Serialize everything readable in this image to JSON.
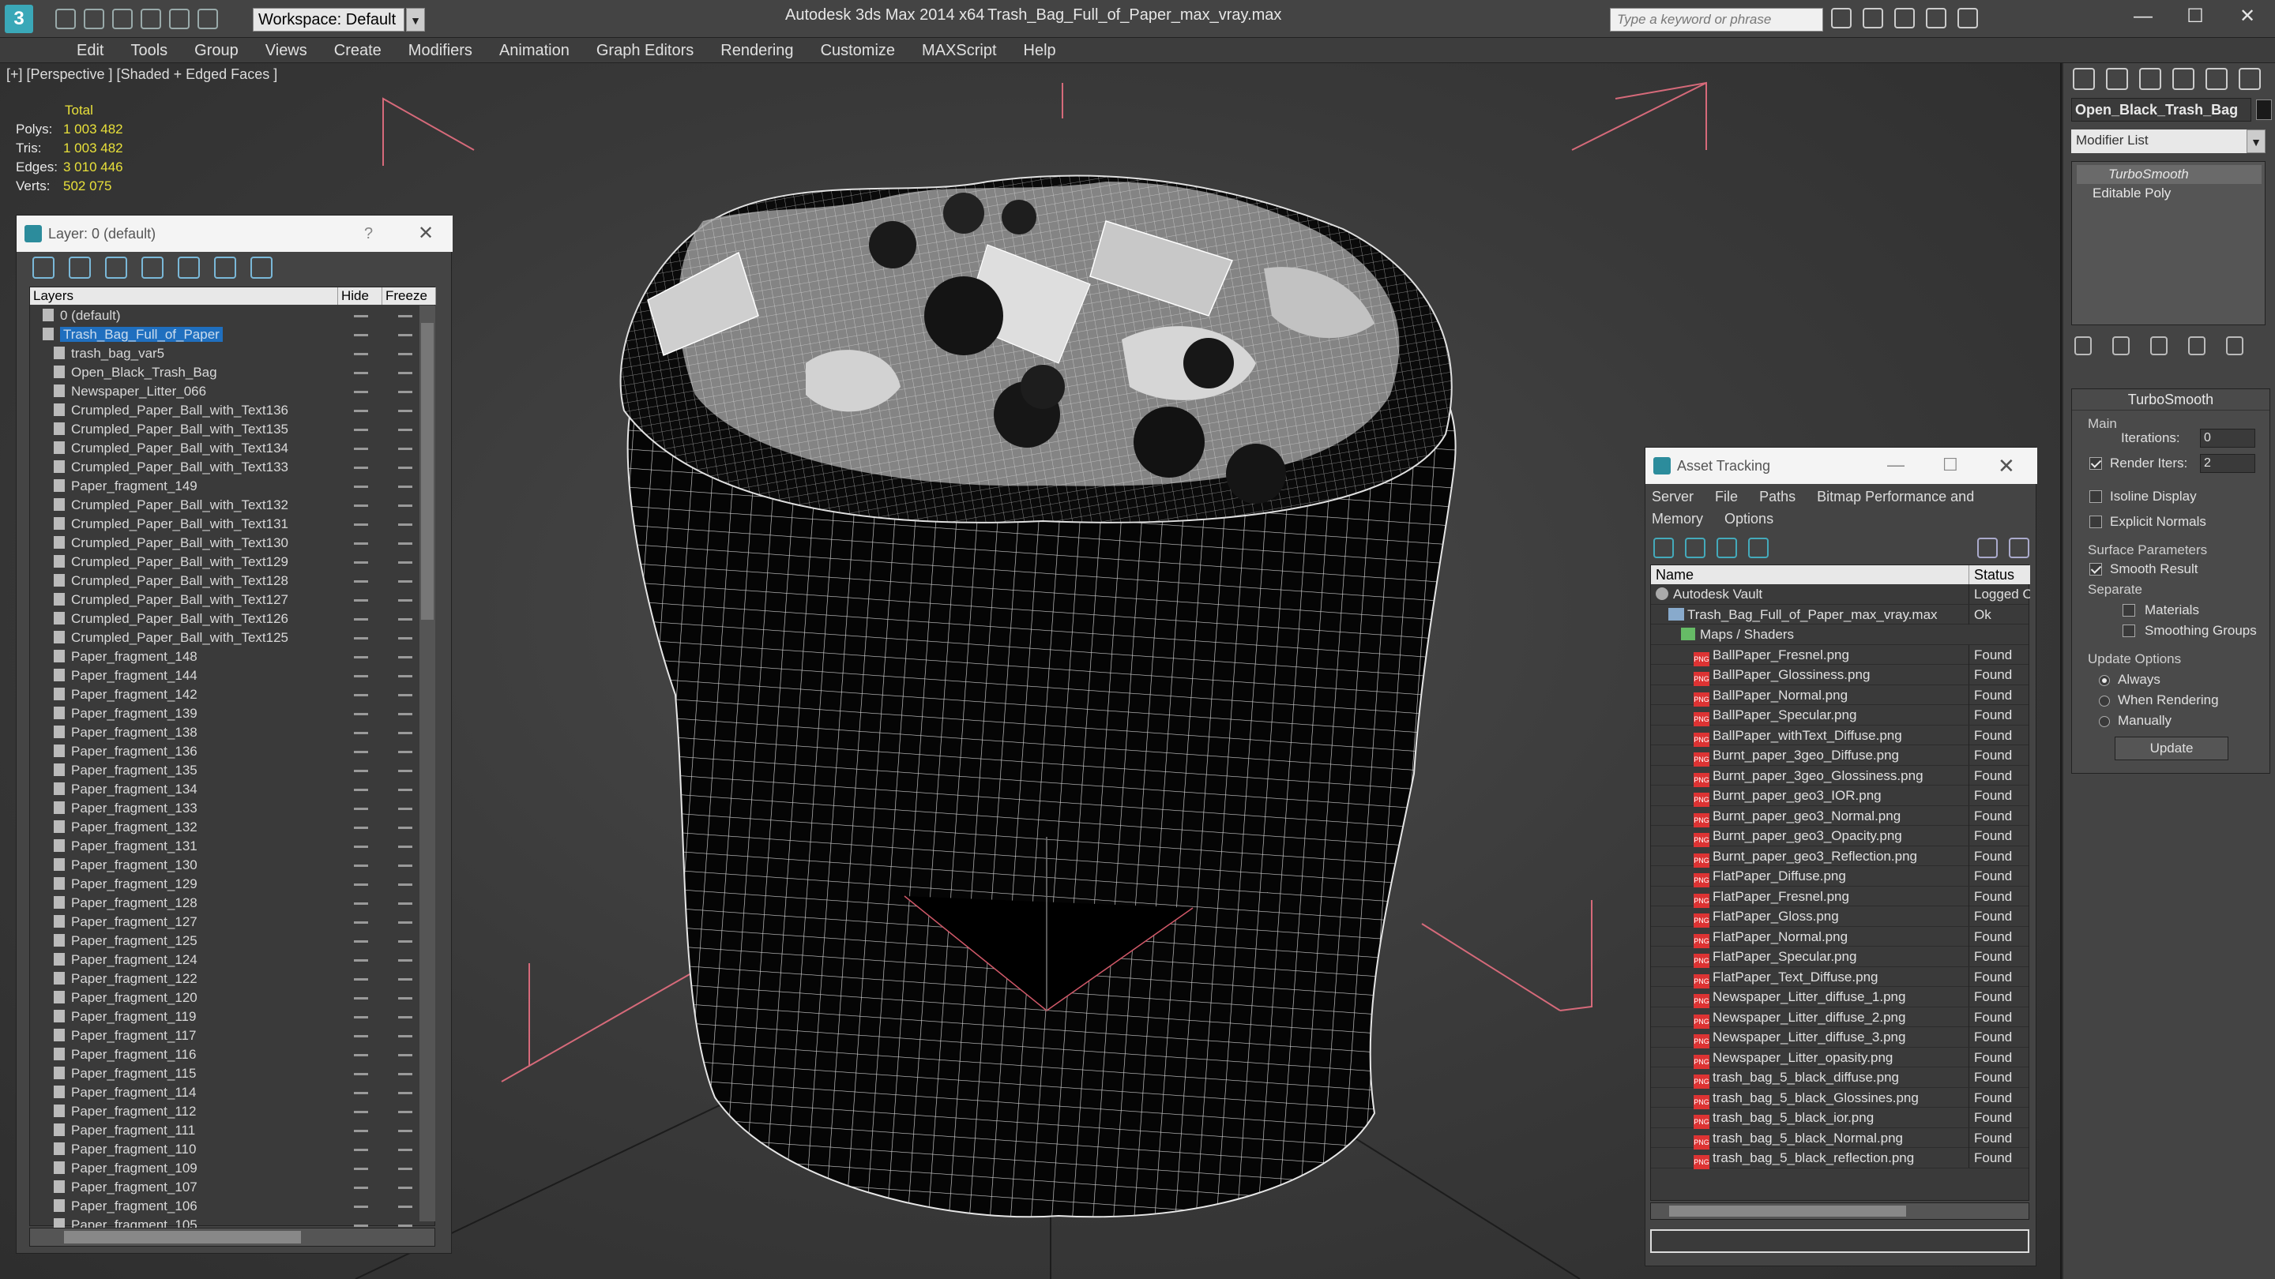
{
  "titlebar": {
    "app_title": "Autodesk 3ds Max  2014 x64",
    "file_title": "Trash_Bag_Full_of_Paper_max_vray.max",
    "logo": "3",
    "workspace": "Workspace: Default",
    "search_placeholder": "Type a keyword or phrase",
    "min": "—",
    "max": "☐",
    "close": "✕"
  },
  "menu": [
    "Edit",
    "Tools",
    "Group",
    "Views",
    "Create",
    "Modifiers",
    "Animation",
    "Graph Editors",
    "Rendering",
    "Customize",
    "MAXScript",
    "Help"
  ],
  "viewport": {
    "label": "[+] [Perspective ] [Shaded + Edged Faces ]",
    "stats": {
      "header": "Total",
      "rows": [
        {
          "k": "Polys:",
          "v": "1 003 482"
        },
        {
          "k": "Tris:",
          "v": "1 003 482"
        },
        {
          "k": "Edges:",
          "v": "3 010 446"
        },
        {
          "k": "Verts:",
          "v": "502 075"
        }
      ]
    }
  },
  "layer_panel": {
    "title": "Layer: 0 (default)",
    "help": "?",
    "close": "✕",
    "col_layers": "Layers",
    "col_hide": "Hide",
    "col_freeze": "Freeze",
    "rows": [
      {
        "name": "0 (default)",
        "indent": 1
      },
      {
        "name": "Trash_Bag_Full_of_Paper",
        "indent": 1,
        "selected": true
      },
      {
        "name": "trash_bag_var5",
        "indent": 2
      },
      {
        "name": "Open_Black_Trash_Bag",
        "indent": 2
      },
      {
        "name": "Newspaper_Litter_066",
        "indent": 2
      },
      {
        "name": "Crumpled_Paper_Ball_with_Text136",
        "indent": 2
      },
      {
        "name": "Crumpled_Paper_Ball_with_Text135",
        "indent": 2
      },
      {
        "name": "Crumpled_Paper_Ball_with_Text134",
        "indent": 2
      },
      {
        "name": "Crumpled_Paper_Ball_with_Text133",
        "indent": 2
      },
      {
        "name": "Paper_fragment_149",
        "indent": 2
      },
      {
        "name": "Crumpled_Paper_Ball_with_Text132",
        "indent": 2
      },
      {
        "name": "Crumpled_Paper_Ball_with_Text131",
        "indent": 2
      },
      {
        "name": "Crumpled_Paper_Ball_with_Text130",
        "indent": 2
      },
      {
        "name": "Crumpled_Paper_Ball_with_Text129",
        "indent": 2
      },
      {
        "name": "Crumpled_Paper_Ball_with_Text128",
        "indent": 2
      },
      {
        "name": "Crumpled_Paper_Ball_with_Text127",
        "indent": 2
      },
      {
        "name": "Crumpled_Paper_Ball_with_Text126",
        "indent": 2
      },
      {
        "name": "Crumpled_Paper_Ball_with_Text125",
        "indent": 2
      },
      {
        "name": "Paper_fragment_148",
        "indent": 2
      },
      {
        "name": "Paper_fragment_144",
        "indent": 2
      },
      {
        "name": "Paper_fragment_142",
        "indent": 2
      },
      {
        "name": "Paper_fragment_139",
        "indent": 2
      },
      {
        "name": "Paper_fragment_138",
        "indent": 2
      },
      {
        "name": "Paper_fragment_136",
        "indent": 2
      },
      {
        "name": "Paper_fragment_135",
        "indent": 2
      },
      {
        "name": "Paper_fragment_134",
        "indent": 2
      },
      {
        "name": "Paper_fragment_133",
        "indent": 2
      },
      {
        "name": "Paper_fragment_132",
        "indent": 2
      },
      {
        "name": "Paper_fragment_131",
        "indent": 2
      },
      {
        "name": "Paper_fragment_130",
        "indent": 2
      },
      {
        "name": "Paper_fragment_129",
        "indent": 2
      },
      {
        "name": "Paper_fragment_128",
        "indent": 2
      },
      {
        "name": "Paper_fragment_127",
        "indent": 2
      },
      {
        "name": "Paper_fragment_125",
        "indent": 2
      },
      {
        "name": "Paper_fragment_124",
        "indent": 2
      },
      {
        "name": "Paper_fragment_122",
        "indent": 2
      },
      {
        "name": "Paper_fragment_120",
        "indent": 2
      },
      {
        "name": "Paper_fragment_119",
        "indent": 2
      },
      {
        "name": "Paper_fragment_117",
        "indent": 2
      },
      {
        "name": "Paper_fragment_116",
        "indent": 2
      },
      {
        "name": "Paper_fragment_115",
        "indent": 2
      },
      {
        "name": "Paper_fragment_114",
        "indent": 2
      },
      {
        "name": "Paper_fragment_112",
        "indent": 2
      },
      {
        "name": "Paper_fragment_111",
        "indent": 2
      },
      {
        "name": "Paper_fragment_110",
        "indent": 2
      },
      {
        "name": "Paper_fragment_109",
        "indent": 2
      },
      {
        "name": "Paper_fragment_107",
        "indent": 2
      },
      {
        "name": "Paper_fragment_106",
        "indent": 2
      },
      {
        "name": "Paper_fragment_105",
        "indent": 2
      }
    ]
  },
  "asset_panel": {
    "title": "Asset Tracking",
    "menu": [
      "Server",
      "File",
      "Paths",
      "Bitmap Performance and Memory",
      "Options"
    ],
    "col_name": "Name",
    "col_status": "Status",
    "rows": [
      {
        "name": "Autodesk Vault",
        "status": "Logged Out",
        "type": "vault",
        "indent": 1
      },
      {
        "name": "Trash_Bag_Full_of_Paper_max_vray.max",
        "status": "Ok",
        "type": "max",
        "indent": 2
      },
      {
        "name": "Maps / Shaders",
        "status": "",
        "type": "folder",
        "indent": 3
      },
      {
        "name": "BallPaper_Fresnel.png",
        "status": "Found",
        "type": "png",
        "indent": 4
      },
      {
        "name": "BallPaper_Glossiness.png",
        "status": "Found",
        "type": "png",
        "indent": 4
      },
      {
        "name": "BallPaper_Normal.png",
        "status": "Found",
        "type": "png",
        "indent": 4
      },
      {
        "name": "BallPaper_Specular.png",
        "status": "Found",
        "type": "png",
        "indent": 4
      },
      {
        "name": "BallPaper_withText_Diffuse.png",
        "status": "Found",
        "type": "png",
        "indent": 4
      },
      {
        "name": "Burnt_paper_3geo_Diffuse.png",
        "status": "Found",
        "type": "png",
        "indent": 4
      },
      {
        "name": "Burnt_paper_3geo_Glossiness.png",
        "status": "Found",
        "type": "png",
        "indent": 4
      },
      {
        "name": "Burnt_paper_geo3_IOR.png",
        "status": "Found",
        "type": "png",
        "indent": 4
      },
      {
        "name": "Burnt_paper_geo3_Normal.png",
        "status": "Found",
        "type": "png",
        "indent": 4
      },
      {
        "name": "Burnt_paper_geo3_Opacity.png",
        "status": "Found",
        "type": "png",
        "indent": 4
      },
      {
        "name": "Burnt_paper_geo3_Reflection.png",
        "status": "Found",
        "type": "png",
        "indent": 4
      },
      {
        "name": "FlatPaper_Diffuse.png",
        "status": "Found",
        "type": "png",
        "indent": 4
      },
      {
        "name": "FlatPaper_Fresnel.png",
        "status": "Found",
        "type": "png",
        "indent": 4
      },
      {
        "name": "FlatPaper_Gloss.png",
        "status": "Found",
        "type": "png",
        "indent": 4
      },
      {
        "name": "FlatPaper_Normal.png",
        "status": "Found",
        "type": "png",
        "indent": 4
      },
      {
        "name": "FlatPaper_Specular.png",
        "status": "Found",
        "type": "png",
        "indent": 4
      },
      {
        "name": "FlatPaper_Text_Diffuse.png",
        "status": "Found",
        "type": "png",
        "indent": 4
      },
      {
        "name": "Newspaper_Litter_diffuse_1.png",
        "status": "Found",
        "type": "png",
        "indent": 4
      },
      {
        "name": "Newspaper_Litter_diffuse_2.png",
        "status": "Found",
        "type": "png",
        "indent": 4
      },
      {
        "name": "Newspaper_Litter_diffuse_3.png",
        "status": "Found",
        "type": "png",
        "indent": 4
      },
      {
        "name": "Newspaper_Litter_opasity.png",
        "status": "Found",
        "type": "png",
        "indent": 4
      },
      {
        "name": "trash_bag_5_black_diffuse.png",
        "status": "Found",
        "type": "png",
        "indent": 4
      },
      {
        "name": "trash_bag_5_black_Glossines.png",
        "status": "Found",
        "type": "png",
        "indent": 4
      },
      {
        "name": "trash_bag_5_black_ior.png",
        "status": "Found",
        "type": "png",
        "indent": 4
      },
      {
        "name": "trash_bag_5_black_Normal.png",
        "status": "Found",
        "type": "png",
        "indent": 4
      },
      {
        "name": "trash_bag_5_black_reflection.png",
        "status": "Found",
        "type": "png",
        "indent": 4
      }
    ]
  },
  "command_panel": {
    "object_name": "Open_Black_Trash_Bag",
    "modifier_list": "Modifier List",
    "stack": [
      "TurboSmooth",
      "Editable Poly"
    ],
    "turbosmooth": {
      "header": "TurboSmooth",
      "main": "Main",
      "iterations_label": "Iterations:",
      "iterations": "0",
      "render_iters_label": "Render Iters:",
      "render_iters": "2",
      "isoline": "Isoline Display",
      "explicit": "Explicit Normals",
      "surface": "Surface Parameters",
      "smooth_result": "Smooth Result",
      "separate": "Separate",
      "materials": "Materials",
      "smoothing_groups": "Smoothing Groups",
      "update_options": "Update Options",
      "always": "Always",
      "when_rendering": "When Rendering",
      "manually": "Manually",
      "update": "Update"
    }
  }
}
